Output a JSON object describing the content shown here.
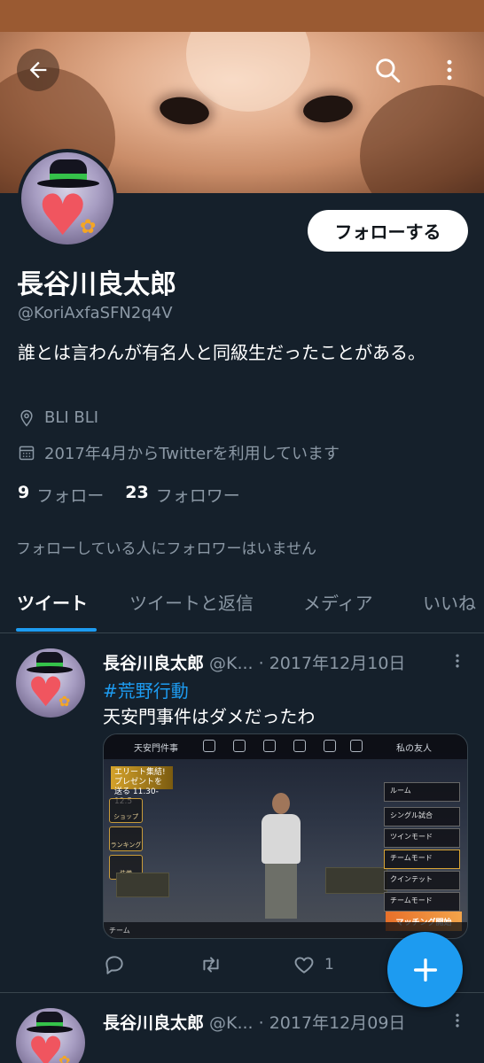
{
  "profile": {
    "display_name": "長谷川良太郎",
    "handle": "@KoriAxfaSFN2q4V",
    "bio": "誰とは言わんが有名人と同級生だったことがある。",
    "location": "BLI BLI",
    "joined": "2017年4月からTwitterを利用しています",
    "following_count": "9",
    "following_label": "フォロー",
    "followers_count": "23",
    "followers_label": "フォロワー",
    "followers_note": "フォローしている人にフォロワーはいません",
    "follow_button": "フォローする"
  },
  "tabs": [
    {
      "label": "ツイート",
      "active": true
    },
    {
      "label": "ツイートと返信",
      "active": false
    },
    {
      "label": "メディア",
      "active": false
    },
    {
      "label": "いいね",
      "active": false
    }
  ],
  "tweets": [
    {
      "name": "長谷川良太郎",
      "meta": "@K... · 2017年12月10日",
      "hashtag": "#荒野行動",
      "text": "天安門事件はダメだったわ",
      "media": {
        "title": "天安門件事",
        "friends": "私の友人",
        "event": "エリート集結! プレゼントを送る 11.30-12.5",
        "side_items": [
          "ショップ",
          "ランキング",
          "装備"
        ],
        "menu_items": [
          "ルーム",
          "シングル試合",
          "ツインモード",
          "チームモード",
          "クインテット",
          "チームモード"
        ],
        "match_button": "マッチング開始",
        "bottom_label": "チーム"
      },
      "likes": "1"
    },
    {
      "name": "長谷川良太郎",
      "meta": "@K... · 2017年12月09日"
    }
  ],
  "icons": {
    "back": "arrow-left-icon",
    "search": "search-icon",
    "more": "more-vertical-icon",
    "location": "map-pin-icon",
    "calendar": "calendar-icon",
    "reply": "reply-icon",
    "retweet": "retweet-icon",
    "like": "heart-icon",
    "compose": "plus-icon"
  },
  "colors": {
    "background": "#15202b",
    "accent": "#1d9bf0",
    "secondary_text": "#8b98a5",
    "divider": "#38444d"
  }
}
